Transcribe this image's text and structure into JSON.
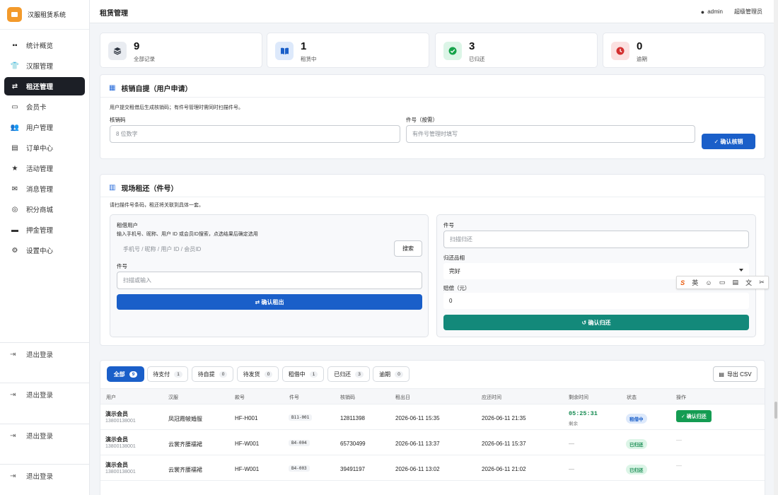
{
  "app": {
    "name": "汉服租赁系统"
  },
  "sidebar": {
    "items": [
      {
        "label": "统计概览",
        "icon": "grid-icon"
      },
      {
        "label": "汉服管理",
        "icon": "shirt-icon"
      },
      {
        "label": "租还管理",
        "icon": "exchange-icon",
        "active": true
      },
      {
        "label": "会员卡",
        "icon": "id-card-icon"
      },
      {
        "label": "用户管理",
        "icon": "users-icon"
      },
      {
        "label": "订单中心",
        "icon": "receipt-icon"
      },
      {
        "label": "活动管理",
        "icon": "star-icon"
      },
      {
        "label": "消息管理",
        "icon": "envelope-icon"
      },
      {
        "label": "积分商城",
        "icon": "coins-icon"
      },
      {
        "label": "押金管理",
        "icon": "wallet-icon"
      },
      {
        "label": "设置中心",
        "icon": "gear-icon"
      }
    ],
    "logout_label": "退出登录"
  },
  "header": {
    "title": "租赁管理",
    "user": "admin",
    "role": "超级管理员"
  },
  "stats": [
    {
      "value": "9",
      "label": "全部记录",
      "color": "#e9ecf1"
    },
    {
      "value": "1",
      "label": "租赁中",
      "color": "#dde9fb"
    },
    {
      "value": "3",
      "label": "已归还",
      "color": "#dcf5e7"
    },
    {
      "value": "0",
      "label": "逾期",
      "color": "#fbe0e0"
    }
  ],
  "verify": {
    "title": "核销自提（用户申请）",
    "hint": "用户提交租借后生成核销码；有件号管理时需同时扫描件号。",
    "code_label": "核销码",
    "code_placeholder": "8 位数字",
    "item_label": "件号（按需）",
    "item_placeholder": "有件号管理时填写",
    "confirm_label": "✓ 确认核销"
  },
  "onsite": {
    "title": "现场租还（件号）",
    "hint": "请扫描件号条码，租还将关联到具体一套。",
    "rent": {
      "user_label": "租借用户",
      "user_hint": "输入手机号、昵称、用户 ID 或会员ID搜索，点选结果后确定选用",
      "search_placeholder": "手机号 / 昵称 / 用户 ID / 会员ID",
      "search_button": "搜索",
      "item_label": "件号",
      "item_placeholder": "扫描或输入",
      "confirm_label": "⇄ 确认租出"
    },
    "ret": {
      "item_label": "件号",
      "item_placeholder": "扫描归还",
      "condition_label": "归还品相",
      "condition_value": "完好",
      "comp_label": "赔偿（元）",
      "comp_value": "0",
      "confirm_label": "↺ 确认归还"
    }
  },
  "ime": {
    "items": [
      "S",
      "英",
      "☺",
      "▭",
      "▤",
      "文",
      "✂"
    ]
  },
  "records": {
    "tabs": [
      {
        "label": "全部",
        "count": "9",
        "active": true
      },
      {
        "label": "待支付",
        "count": "1"
      },
      {
        "label": "待自提",
        "count": "0"
      },
      {
        "label": "待发货",
        "count": "0"
      },
      {
        "label": "租借中",
        "count": "1"
      },
      {
        "label": "已归还",
        "count": "3"
      },
      {
        "label": "逾期",
        "count": "0"
      }
    ],
    "export_label": "导出 CSV",
    "columns": [
      "用户",
      "汉服",
      "款号",
      "件号",
      "核销码",
      "租出日",
      "应还时间",
      "剩余时间",
      "状态",
      "操作"
    ],
    "rows": [
      {
        "user": "演示会员",
        "phone": "13800138001",
        "hanfu": "凤冠霞帔婚服",
        "style": "HF-H001",
        "item": "B11-001",
        "code": "12811398",
        "out": "2026-06-11 15:35",
        "due": "2026-06-11 21:35",
        "remaining": "05:25:31",
        "remaining_sub": "剩余",
        "status": "租借中",
        "status_type": "blue",
        "action": "✓ 确认归还"
      },
      {
        "user": "演示会员",
        "phone": "13800138001",
        "hanfu": "云裳齐腰襦裙",
        "style": "HF-W001",
        "item": "B4-004",
        "code": "65730499",
        "out": "2026-06-11 13:37",
        "due": "2026-06-11 15:37",
        "remaining": "—",
        "status": "已归还",
        "status_type": "green",
        "action": "—"
      },
      {
        "user": "演示会员",
        "phone": "13800138001",
        "hanfu": "云裳齐腰襦裙",
        "style": "HF-W001",
        "item": "B4-003",
        "code": "39491197",
        "out": "2026-06-11 13:02",
        "due": "2026-06-11 21:02",
        "remaining": "—",
        "status": "已归还",
        "status_type": "green",
        "action": "—"
      }
    ]
  }
}
